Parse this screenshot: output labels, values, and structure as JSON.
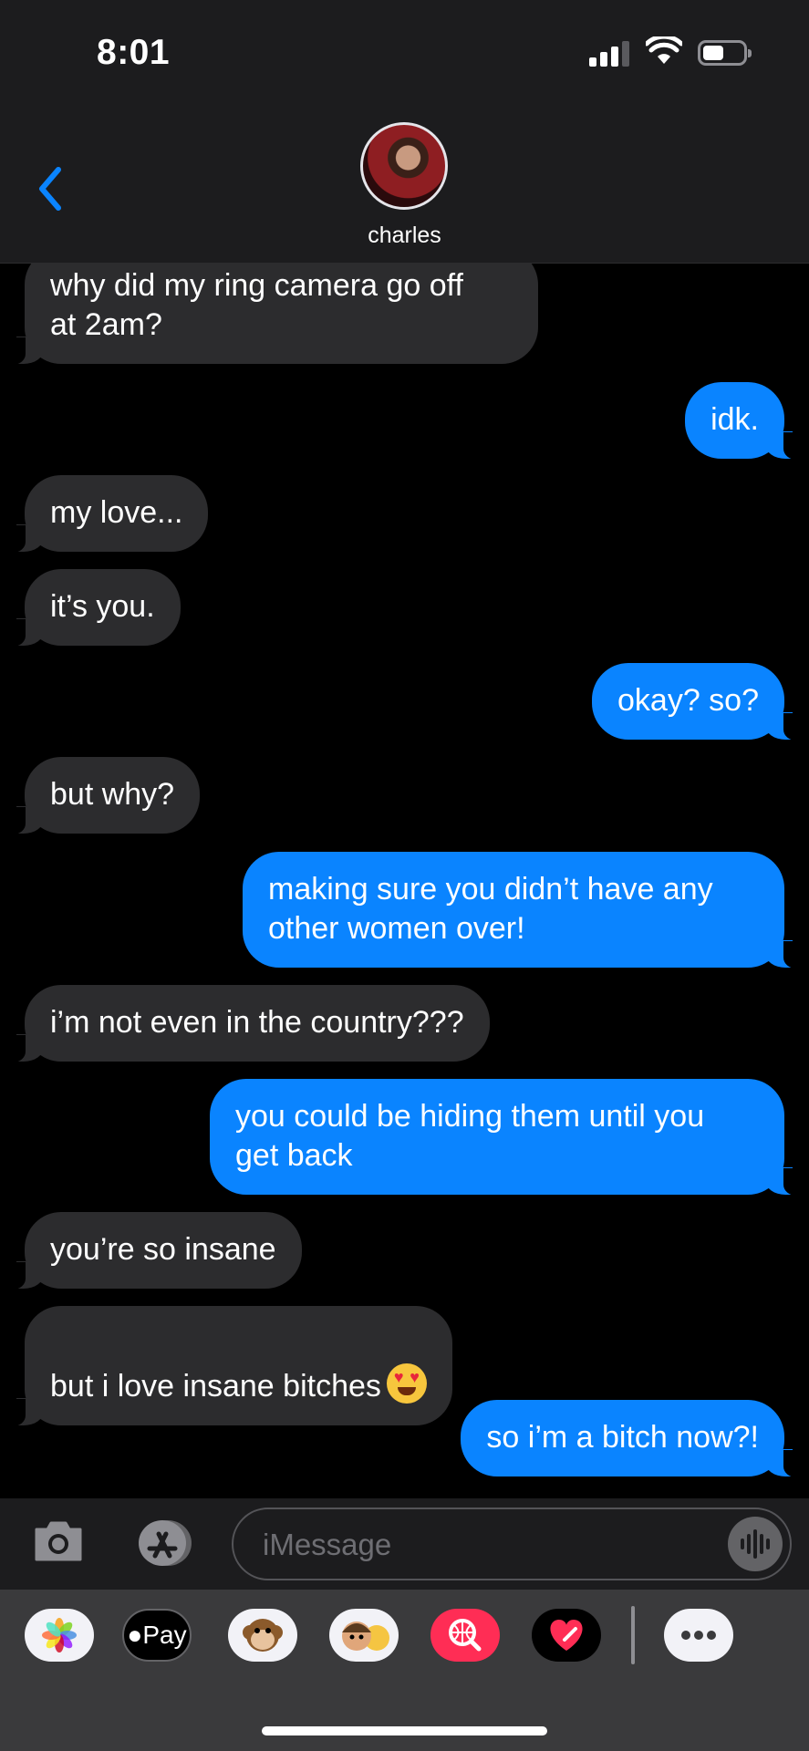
{
  "status_bar": {
    "time": "8:01"
  },
  "header": {
    "contact_name": "charles"
  },
  "messages": [
    {
      "side": "in",
      "text": "why did my ring camera go off\nat 2am?"
    },
    {
      "side": "out",
      "text": "idk."
    },
    {
      "side": "in",
      "text": "my love..."
    },
    {
      "side": "in",
      "text": "it’s you."
    },
    {
      "side": "out",
      "text": "okay? so?"
    },
    {
      "side": "in",
      "text": "but why?"
    },
    {
      "side": "out",
      "text": "making sure you didn’t have any\nother women over!"
    },
    {
      "side": "in",
      "text": "i’m not even in the country???"
    },
    {
      "side": "out",
      "text": "you could be hiding them until you\nget back"
    },
    {
      "side": "in",
      "text": "you’re so insane"
    },
    {
      "side": "in",
      "text": "but i love insane bitches",
      "emoji": "heart-eyes-emoji"
    },
    {
      "side": "out",
      "text": "so i’m a bitch now?!"
    }
  ],
  "input": {
    "placeholder": "iMessage"
  },
  "app_drawer": {
    "pay_label": "Pay"
  },
  "colors": {
    "outgoing": "#0a84ff",
    "incoming": "#2c2c2e",
    "accent": "#0a84ff"
  }
}
